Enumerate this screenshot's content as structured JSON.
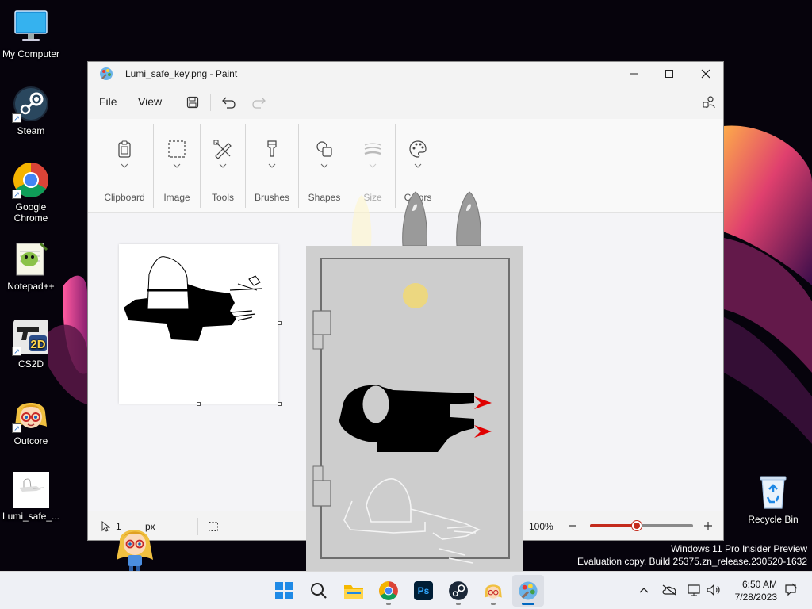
{
  "desktop": {
    "icons": [
      {
        "label": "My Computer",
        "icon": "monitor-icon"
      },
      {
        "label": "Steam",
        "icon": "steam-icon"
      },
      {
        "label": "Google Chrome",
        "icon": "chrome-icon"
      },
      {
        "label": "Notepad++",
        "icon": "notepad-plus-plus-icon"
      },
      {
        "label": "CS2D",
        "icon": "cs2d-icon"
      },
      {
        "label": "Outcore",
        "icon": "outcore-icon"
      },
      {
        "label": "Lumi_safe_...",
        "icon": "image-file-icon"
      }
    ],
    "recycle_bin": {
      "label": "Recycle Bin",
      "icon": "recycle-bin-icon"
    }
  },
  "paint": {
    "title": "Lumi_safe_key.png - Paint",
    "menu": {
      "file": "File",
      "view": "View"
    },
    "ribbon": {
      "groups": [
        {
          "label": "Clipboard",
          "icon": "clipboard-icon"
        },
        {
          "label": "Image",
          "icon": "selection-icon"
        },
        {
          "label": "Tools",
          "icon": "tools-icon"
        },
        {
          "label": "Brushes",
          "icon": "brush-icon"
        },
        {
          "label": "Shapes",
          "icon": "shapes-icon"
        },
        {
          "label": "Size",
          "icon": "size-icon"
        },
        {
          "label": "Colors",
          "icon": "palette-icon"
        }
      ]
    },
    "status": {
      "cursor_position": "1",
      "cursor_unit": "px",
      "zoom_label": "100%",
      "zoom_level": 0.45
    }
  },
  "watermark": {
    "line1": "Windows 11 Pro Insider Preview",
    "line2": "Evaluation copy. Build 25375.zn_release.230520-1632"
  },
  "taskbar": {
    "apps": [
      "start-icon",
      "search-icon",
      "file-explorer-icon",
      "chrome-icon",
      "photoshop-icon",
      "steam-icon",
      "outcore-icon",
      "paint-icon"
    ],
    "photoshop_label": "Ps",
    "time": "6:50 AM",
    "date": "7/28/2023"
  },
  "colors": {
    "accent": "#0067c0",
    "zoom_accent": "#c42b1c"
  }
}
